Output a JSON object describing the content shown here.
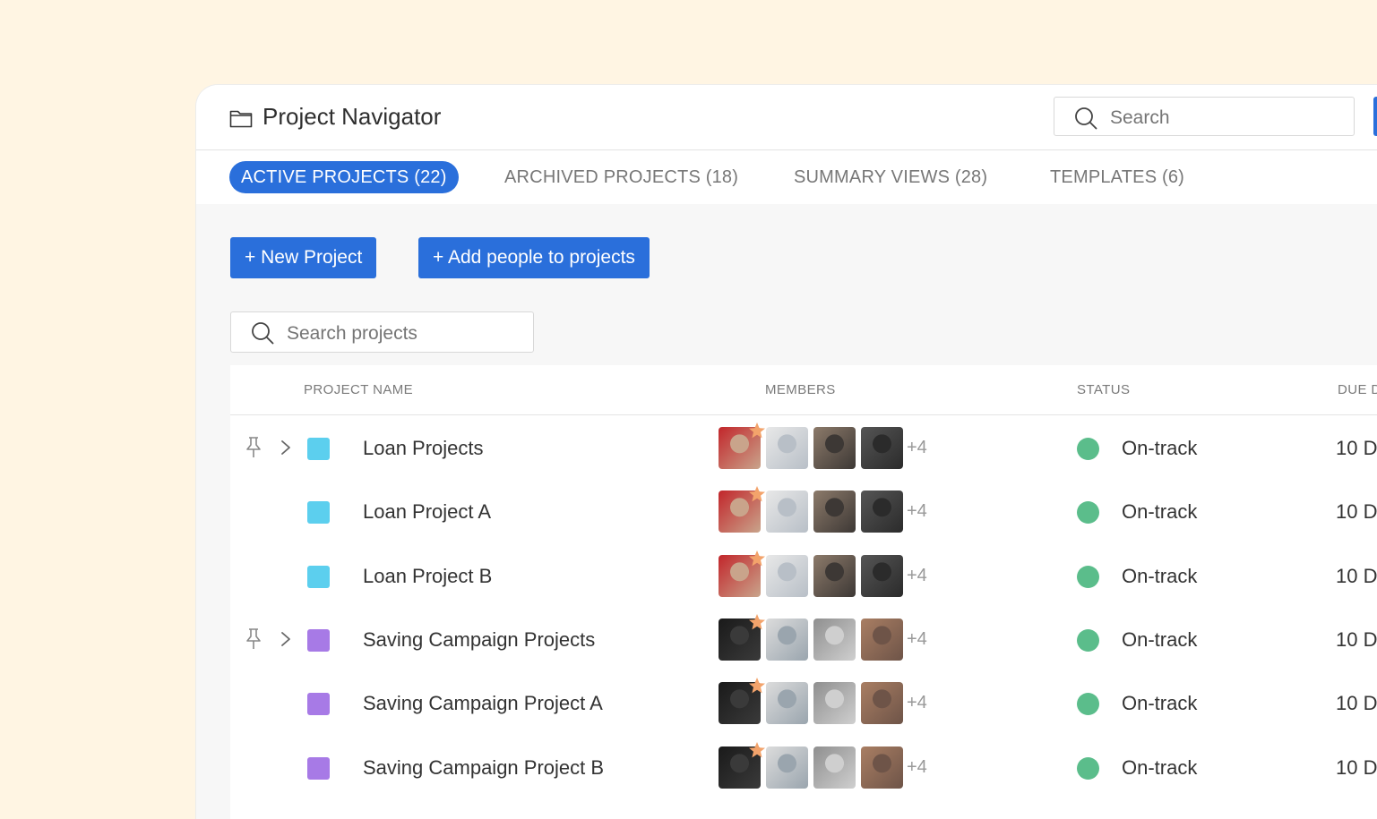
{
  "app": {
    "title": "Project Navigator"
  },
  "header": {
    "search_placeholder": "Search"
  },
  "tabs": [
    {
      "label": "ACTIVE PROJECTS (22)",
      "active": true
    },
    {
      "label": "ARCHIVED PROJECTS (18)",
      "active": false
    },
    {
      "label": "SUMMARY VIEWS (28)",
      "active": false
    },
    {
      "label": "TEMPLATES (6)",
      "active": false
    }
  ],
  "toolbar": {
    "new_project_label": "+ New Project",
    "add_people_label": "+ Add people to projects"
  },
  "project_search": {
    "placeholder": "Search projects"
  },
  "table": {
    "columns": {
      "project_name": "PROJECT NAME",
      "members": "MEMBERS",
      "status": "STATUS",
      "due": "DUE D"
    },
    "rows": [
      {
        "name": "Loan Projects",
        "pinned": true,
        "expandable": true,
        "color": "#5ccfee",
        "members_more": "+4",
        "status": "On-track",
        "due": "10 D"
      },
      {
        "name": "Loan Project A",
        "pinned": false,
        "expandable": false,
        "color": "#5ccfee",
        "members_more": "+4",
        "status": "On-track",
        "due": "10 D"
      },
      {
        "name": "Loan Project B",
        "pinned": false,
        "expandable": false,
        "color": "#5ccfee",
        "members_more": "+4",
        "status": "On-track",
        "due": "10 D"
      },
      {
        "name": "Saving Campaign Projects",
        "pinned": true,
        "expandable": true,
        "color": "#a77ae6",
        "members_more": "+4",
        "status": "On-track",
        "due": "10 D"
      },
      {
        "name": "Saving Campaign Project A",
        "pinned": false,
        "expandable": false,
        "color": "#a77ae6",
        "members_more": "+4",
        "status": "On-track",
        "due": "10 D"
      },
      {
        "name": "Saving Campaign Project B",
        "pinned": false,
        "expandable": false,
        "color": "#a77ae6",
        "members_more": "+4",
        "status": "On-track",
        "due": "10 D"
      }
    ]
  },
  "colors": {
    "accent": "#2a6fdb",
    "status_on_track": "#5bbd8b",
    "star": "#f3a36b"
  },
  "icons": {
    "folder": "folder-icon",
    "search": "search-icon",
    "pin": "pin-icon",
    "chevron": "chevron-right-icon",
    "star": "star-icon"
  }
}
